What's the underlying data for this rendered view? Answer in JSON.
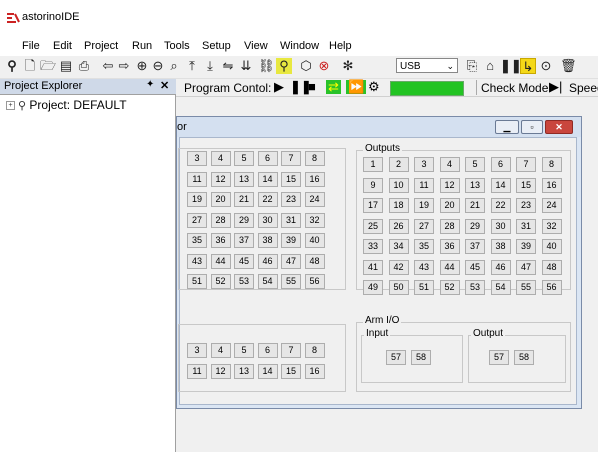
{
  "app": {
    "title": "astorinoIDE",
    "accent": "#cc2222"
  },
  "menu": [
    "File",
    "Edit",
    "Project",
    "Run",
    "Tools",
    "Setup",
    "View",
    "Window",
    "Help"
  ],
  "toolbar": {
    "icons": [
      "new-project-icon",
      "new-file-icon",
      "open-folder-icon",
      "save-icon",
      "print-icon",
      "undo-icon",
      "redo-icon",
      "zoom-in-icon",
      "zoom-out-icon",
      "zoom-reset-icon",
      "upload-icon",
      "download-icon",
      "compare-icon",
      "download-alt-icon",
      "gamepad-icon",
      "robot-connect-icon",
      "robot-icon",
      "disconnect-icon",
      "bluetooth-icon"
    ],
    "port_value": "USB",
    "right_icons": [
      "file-copy-icon",
      "home-icon",
      "pause-icon",
      "step-icon",
      "target-icon",
      "trash-icon"
    ]
  },
  "explorer": {
    "header": "Project Explorer",
    "pin": "✦",
    "close": "✕",
    "project": "Project: DEFAULT"
  },
  "program_control": {
    "label": "Program Contol:",
    "check_label": "Check Mode:",
    "speed_label": "Speed",
    "status_color": "#22c322"
  },
  "io_window": {
    "title_fragment": "or",
    "outputs_label": "Outputs",
    "inputs_numbers": [
      [
        "3",
        "4",
        "5",
        "6",
        "7",
        "8"
      ],
      [
        "11",
        "12",
        "13",
        "14",
        "15",
        "16"
      ],
      [
        "19",
        "20",
        "21",
        "22",
        "23",
        "24"
      ],
      [
        "27",
        "28",
        "29",
        "30",
        "31",
        "32"
      ],
      [
        "35",
        "36",
        "37",
        "38",
        "39",
        "40"
      ],
      [
        "43",
        "44",
        "45",
        "46",
        "47",
        "48"
      ],
      [
        "51",
        "52",
        "53",
        "54",
        "55",
        "56"
      ]
    ],
    "outputs_numbers": [
      [
        "1",
        "2",
        "3",
        "4",
        "5",
        "6",
        "7",
        "8"
      ],
      [
        "9",
        "10",
        "11",
        "12",
        "13",
        "14",
        "15",
        "16"
      ],
      [
        "17",
        "18",
        "19",
        "20",
        "21",
        "22",
        "23",
        "24"
      ],
      [
        "25",
        "26",
        "27",
        "28",
        "29",
        "30",
        "31",
        "32"
      ],
      [
        "33",
        "34",
        "35",
        "36",
        "37",
        "38",
        "39",
        "40"
      ],
      [
        "41",
        "42",
        "43",
        "44",
        "45",
        "46",
        "47",
        "48"
      ],
      [
        "49",
        "50",
        "51",
        "52",
        "53",
        "54",
        "55",
        "56"
      ]
    ],
    "lower_left_numbers": [
      [
        "3",
        "4",
        "5",
        "6",
        "7",
        "8"
      ],
      [
        "11",
        "12",
        "13",
        "14",
        "15",
        "16"
      ]
    ],
    "arm_io_label": "Arm I/O",
    "arm_input_label": "Input",
    "arm_output_label": "Output",
    "arm_input_cells": [
      "57",
      "58"
    ],
    "arm_output_cells": [
      "57",
      "58"
    ]
  }
}
